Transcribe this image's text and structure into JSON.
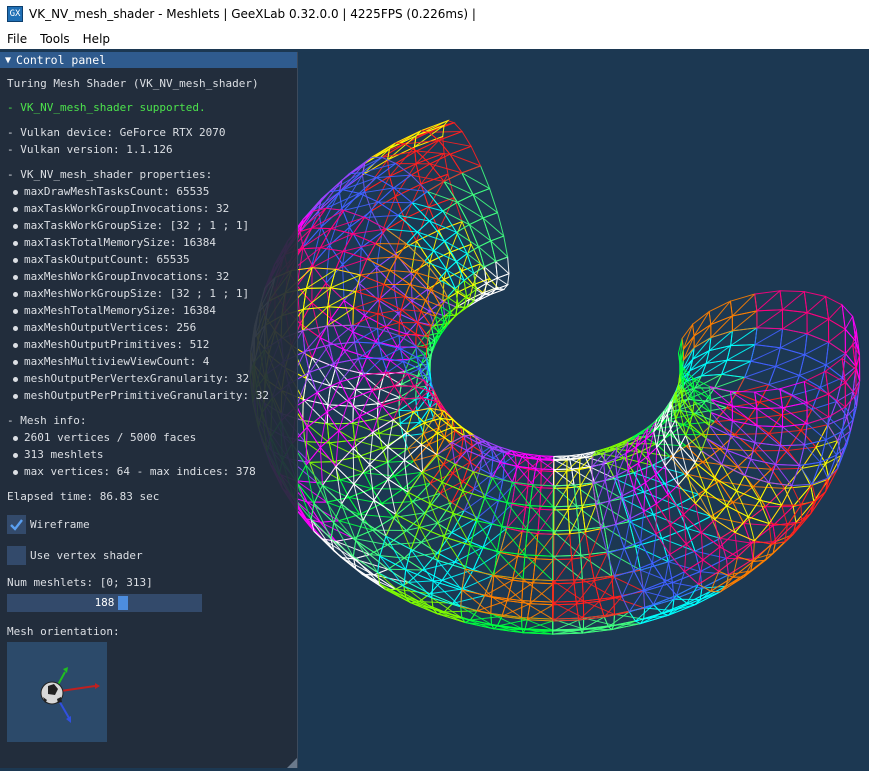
{
  "window": {
    "icon_text": "GX",
    "title": "VK_NV_mesh_shader - Meshlets | GeeXLab 0.32.0.0 | 4225FPS (0.226ms) |"
  },
  "menu": [
    "File",
    "Tools",
    "Help"
  ],
  "panel": {
    "header": "Control panel",
    "heading": "Turing Mesh Shader (VK_NV_mesh_shader)",
    "supported": "- VK_NV_mesh_shader supported.",
    "device": "- Vulkan device: GeForce RTX 2070",
    "version": "- Vulkan version: 1.1.126",
    "props_title": "- VK_NV_mesh_shader properties:",
    "props": [
      "maxDrawMeshTasksCount: 65535",
      "maxTaskWorkGroupInvocations: 32",
      "maxTaskWorkGroupSize: [32 ; 1 ; 1]",
      "maxTaskTotalMemorySize: 16384",
      "maxTaskOutputCount: 65535",
      "maxMeshWorkGroupInvocations: 32",
      "maxMeshWorkGroupSize: [32 ; 1 ; 1]",
      "maxMeshTotalMemorySize: 16384",
      "maxMeshOutputVertices: 256",
      "maxMeshOutputPrimitives: 512",
      "maxMeshMultiviewViewCount: 4",
      "meshOutputPerVertexGranularity: 32",
      "meshOutputPerPrimitiveGranularity: 32"
    ],
    "mesh_title": "- Mesh info:",
    "mesh_info": [
      "2601 vertices / 5000 faces",
      "313 meshlets",
      "max vertices: 64 - max indices: 378"
    ],
    "elapsed": "Elapsed time: 86.83 sec",
    "wireframe_label": "Wireframe",
    "wireframe_checked": true,
    "vertex_shader_label": "Use vertex shader",
    "vertex_shader_checked": false,
    "num_meshlets_label": "Num meshlets: [0; 313]",
    "num_meshlets_value": "188",
    "num_meshlets_fraction": 0.6,
    "orientation_label": "Mesh orientation:"
  },
  "colors": {
    "viewport_bg": "#1c3852",
    "panel_header": "#2f5b8e",
    "accent_green": "#4ce34c",
    "slider_grab": "#4d8dde"
  }
}
